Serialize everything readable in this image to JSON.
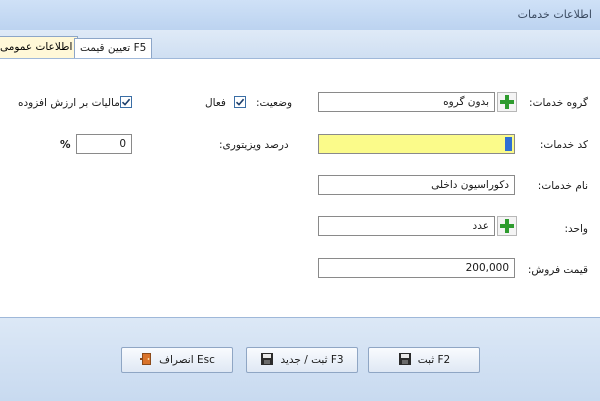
{
  "window": {
    "title": "اطلاعات خدمات"
  },
  "tabs": [
    {
      "label": "اطلاعات عمومی",
      "active": true
    },
    {
      "label": "تعیین قیمت F5",
      "active": false
    }
  ],
  "form": {
    "service_group": {
      "label": "گروه خدمات:",
      "value": "بدون گروه"
    },
    "service_code": {
      "label": "کد خدمات:",
      "value": ""
    },
    "service_name": {
      "label": "نام خدمات:",
      "value": "دکوراسیون داخلی"
    },
    "unit": {
      "label": "واحد:",
      "value": "عدد"
    },
    "sale_price": {
      "label": "قیمت فروش:",
      "value": "200,000"
    },
    "status": {
      "label": "وضعیت:",
      "checkbox_label": "فعال",
      "checked": true
    },
    "visitor_percent": {
      "label": "درصد ویزیتوری:",
      "value": "0",
      "unit": "%"
    },
    "vat": {
      "label": "مالیات بر ارزش افزوده",
      "checked": true
    }
  },
  "buttons": {
    "save": "ثبت F2",
    "save_new": "ثبت / جدید F3",
    "cancel": "انصراف Esc"
  },
  "colors": {
    "accent": "#2f6fd3",
    "highlight_field": "#fbfb8a",
    "active_tab": "#fff8d8"
  }
}
